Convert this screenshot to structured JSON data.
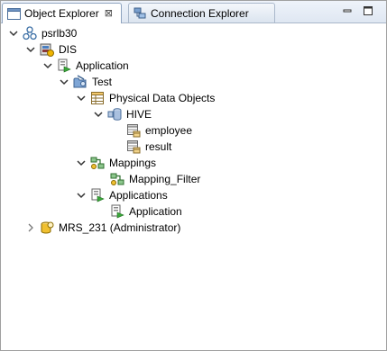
{
  "tabs": [
    {
      "label": "Object Explorer",
      "close_glyph": "⊠",
      "icon": "object-explorer-icon",
      "active": true
    },
    {
      "label": "Connection Explorer",
      "icon": "connection-explorer-icon",
      "active": false
    }
  ],
  "window_controls": {
    "minimize_icon": "minimize-icon",
    "maximize_icon": "maximize-icon"
  },
  "tree": {
    "root": {
      "label": "psrlb30",
      "icon": "domain-icon",
      "expanded": true
    },
    "dis": {
      "label": "DIS",
      "icon": "service-icon",
      "expanded": true
    },
    "application": {
      "label": "Application",
      "icon": "application-icon",
      "expanded": true
    },
    "test": {
      "label": "Test",
      "icon": "project-folder-icon",
      "expanded": true
    },
    "physical_data_objects": {
      "label": "Physical Data Objects",
      "icon": "table-folder-icon",
      "expanded": true
    },
    "hive": {
      "label": "HIVE",
      "icon": "database-icon",
      "expanded": true
    },
    "employee": {
      "label": "employee",
      "icon": "table-icon"
    },
    "result": {
      "label": "result",
      "icon": "table-icon"
    },
    "mappings": {
      "label": "Mappings",
      "icon": "mapping-folder-icon",
      "expanded": true
    },
    "mapping_filter": {
      "label": "Mapping_Filter",
      "icon": "mapping-icon"
    },
    "applications": {
      "label": "Applications",
      "icon": "application-folder-icon",
      "expanded": true
    },
    "application_child": {
      "label": "Application",
      "icon": "application-icon"
    },
    "mrs": {
      "label": "MRS_231 (Administrator)",
      "icon": "repository-icon",
      "expanded": false
    }
  }
}
